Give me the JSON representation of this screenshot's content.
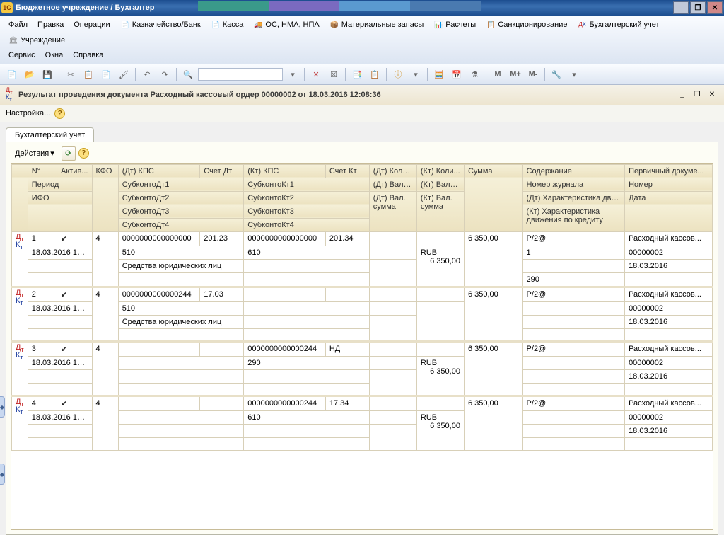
{
  "titlebar": {
    "logo": "1C",
    "title": "Бюджетное учреждение / Бухгалтер"
  },
  "menubar": {
    "row1": [
      {
        "label": "Файл",
        "icon": ""
      },
      {
        "label": "Правка",
        "icon": ""
      },
      {
        "label": "Операции",
        "icon": ""
      },
      {
        "label": "Казначейство/Банк",
        "icon": "📄",
        "color": "#d0a020"
      },
      {
        "label": "Касса",
        "icon": "📄",
        "color": "#d0a020"
      },
      {
        "label": "ОС, НМА, НПА",
        "icon": "🚚",
        "color": "#4080c0"
      },
      {
        "label": "Материальные запасы",
        "icon": "📦",
        "color": "#c08040"
      },
      {
        "label": "Расчеты",
        "icon": "📊",
        "color": "#60a040"
      },
      {
        "label": "Санкционирование",
        "icon": "📋",
        "color": "#8060c0"
      },
      {
        "label": "Бухгалтерский учет",
        "icon": "",
        "dtkt": true
      },
      {
        "label": "Учреждение",
        "icon": "🏛",
        "color": "#808080"
      }
    ],
    "row2": [
      {
        "label": "Сервис"
      },
      {
        "label": "Окна"
      },
      {
        "label": "Справка"
      }
    ]
  },
  "doc_header": "Результат проведения документа Расходный кассовый ордер 00000002 от 18.03.2016 12:08:36",
  "settings_label": "Настройка...",
  "tab_label": "Бухгалтерский учет",
  "actions_label": "Действия",
  "columns": {
    "c1": "",
    "c2": "N°",
    "c3": "Актив...",
    "c4": "КФО",
    "c5": "(Дт) КПС",
    "c6": "Счет Дт",
    "c7": "(Кт) КПС",
    "c8": "Счет Кт",
    "c9": "(Дт) Коли...",
    "c10": "(Кт) Коли...",
    "c11": "Сумма",
    "c12": "Содержание",
    "c13": "Первичный докуме...",
    "r2c2": "Период",
    "r2c5": "СубконтоДт1",
    "r2c7": "СубконтоКт1",
    "r2c9": "(Дт) Валю...",
    "r2c10": "(Кт) Валю...",
    "r2c12": "Номер журнала",
    "r2c13": "Номер",
    "r3c2": "ИФО",
    "r3c5": "СубконтоДт2",
    "r3c7": "СубконтоКт2",
    "r3c9": "(Дт) Вал. сумма",
    "r3c10": "(Кт) Вал. сумма",
    "r3c12": "(Дт) Характеристика дви...",
    "r3c13": "Дата",
    "r4c5": "СубконтоДт3",
    "r4c7": "СубконтоКт3",
    "r4c12": "(Кт) Характеристика движения по кредиту",
    "r5c5": "СубконтоДт4",
    "r5c7": "СубконтоКт4"
  },
  "rows": [
    {
      "num": "1",
      "active": "✔",
      "kfo": "4",
      "dt_kps": "0000000000000000",
      "schet_dt": "201.23",
      "kt_kps": "0000000000000000",
      "schet_kt": "201.34",
      "summa": "6 350,00",
      "soder": "Р/2@",
      "pdoc": "Расходный кассов...",
      "period": "18.03.2016 12:0...",
      "sdt1": "510",
      "skt1": "610",
      "kt_val": "RUB",
      "nomzh": "1",
      "nomer": "00000002",
      "sdt2": "Средства юридических лиц",
      "kt_val_sum": "6 350,00",
      "data": "18.03.2016",
      "kt_char": "290"
    },
    {
      "num": "2",
      "active": "✔",
      "kfo": "4",
      "dt_kps": "0000000000000244",
      "schet_dt": "17.03",
      "kt_kps": "",
      "schet_kt": "",
      "summa": "6 350,00",
      "soder": "Р/2@",
      "pdoc": "Расходный кассов...",
      "period": "18.03.2016 12:0...",
      "sdt1": "510",
      "skt1": "",
      "kt_val": "",
      "nomzh": "",
      "nomer": "00000002",
      "sdt2": "Средства юридических лиц",
      "kt_val_sum": "",
      "data": "18.03.2016",
      "kt_char": ""
    },
    {
      "num": "3",
      "active": "✔",
      "kfo": "4",
      "dt_kps": "",
      "schet_dt": "",
      "kt_kps": "0000000000000244",
      "schet_kt": "НД",
      "summa": "6 350,00",
      "soder": "Р/2@",
      "pdoc": "Расходный кассов...",
      "period": "18.03.2016 12:0...",
      "sdt1": "",
      "skt1": "290",
      "kt_val": "RUB",
      "nomzh": "",
      "nomer": "00000002",
      "sdt2": "",
      "kt_val_sum": "6 350,00",
      "data": "18.03.2016",
      "kt_char": ""
    },
    {
      "num": "4",
      "active": "✔",
      "kfo": "4",
      "dt_kps": "",
      "schet_dt": "",
      "kt_kps": "0000000000000244",
      "schet_kt": "17.34",
      "summa": "6 350,00",
      "soder": "Р/2@",
      "pdoc": "Расходный кассов...",
      "period": "18.03.2016 12:0...",
      "sdt1": "",
      "skt1": "610",
      "kt_val": "RUB",
      "nomzh": "",
      "nomer": "00000002",
      "sdt2": "",
      "kt_val_sum": "6 350,00",
      "data": "18.03.2016",
      "kt_char": ""
    }
  ]
}
